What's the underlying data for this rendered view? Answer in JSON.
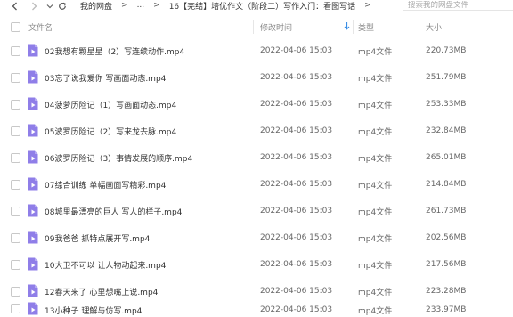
{
  "nav": {
    "back_icon": "chevron-left-icon",
    "forward_icon": "chevron-right-icon",
    "dropdown_icon": "chevron-down-icon",
    "refresh_icon": "refresh-icon"
  },
  "breadcrumb": {
    "root": "我的网盘",
    "sep1": ">",
    "ellipsis": "...",
    "sep2": ">",
    "parent": "16【完结】培优作文（阶段二）写作入门：看图写话",
    "sep3": ">"
  },
  "search": {
    "placeholder": "搜索我的网盘文件"
  },
  "columns": {
    "name": "文件名",
    "modified": "修改时间",
    "type": "类型",
    "size": "大小"
  },
  "accent_color": "#3a8ee6",
  "files": [
    {
      "name": "02我想有颗星星（2）写连续动作.mp4",
      "modified": "2022-04-06 15:03",
      "type": "mp4文件",
      "size": "220.73MB"
    },
    {
      "name": "03忘了说我爱你 写画面动态.mp4",
      "modified": "2022-04-06 15:03",
      "type": "mp4文件",
      "size": "251.79MB"
    },
    {
      "name": "04菠萝历险记（1）写画面动态.mp4",
      "modified": "2022-04-06 15:03",
      "type": "mp4文件",
      "size": "253.33MB"
    },
    {
      "name": "05波罗历险记（2）写来龙去脉.mp4",
      "modified": "2022-04-06 15:03",
      "type": "mp4文件",
      "size": "232.84MB"
    },
    {
      "name": "06波罗历险记（3）事情发展的顺序.mp4",
      "modified": "2022-04-06 15:03",
      "type": "mp4文件",
      "size": "265.01MB"
    },
    {
      "name": "07综合训练 单幅画面写精彩.mp4",
      "modified": "2022-04-06 15:03",
      "type": "mp4文件",
      "size": "214.84MB"
    },
    {
      "name": "08城里最漂亮的巨人  写人的样子.mp4",
      "modified": "2022-04-06 15:03",
      "type": "mp4文件",
      "size": "261.73MB"
    },
    {
      "name": "09我爸爸 抓特点展开写.mp4",
      "modified": "2022-04-06 15:03",
      "type": "mp4文件",
      "size": "202.56MB"
    },
    {
      "name": "10大卫不可以 让人物动起来.mp4",
      "modified": "2022-04-06 15:03",
      "type": "mp4文件",
      "size": "217.56MB"
    },
    {
      "name": "12春天来了 心里想嘴上说.mp4",
      "modified": "2022-04-06 15:03",
      "type": "mp4文件",
      "size": "223.28MB"
    },
    {
      "name": "13小种子 理解与仿写.mp4",
      "modified": "2022-04-06 15:03",
      "type": "mp4文件",
      "size": "233.97MB"
    }
  ]
}
